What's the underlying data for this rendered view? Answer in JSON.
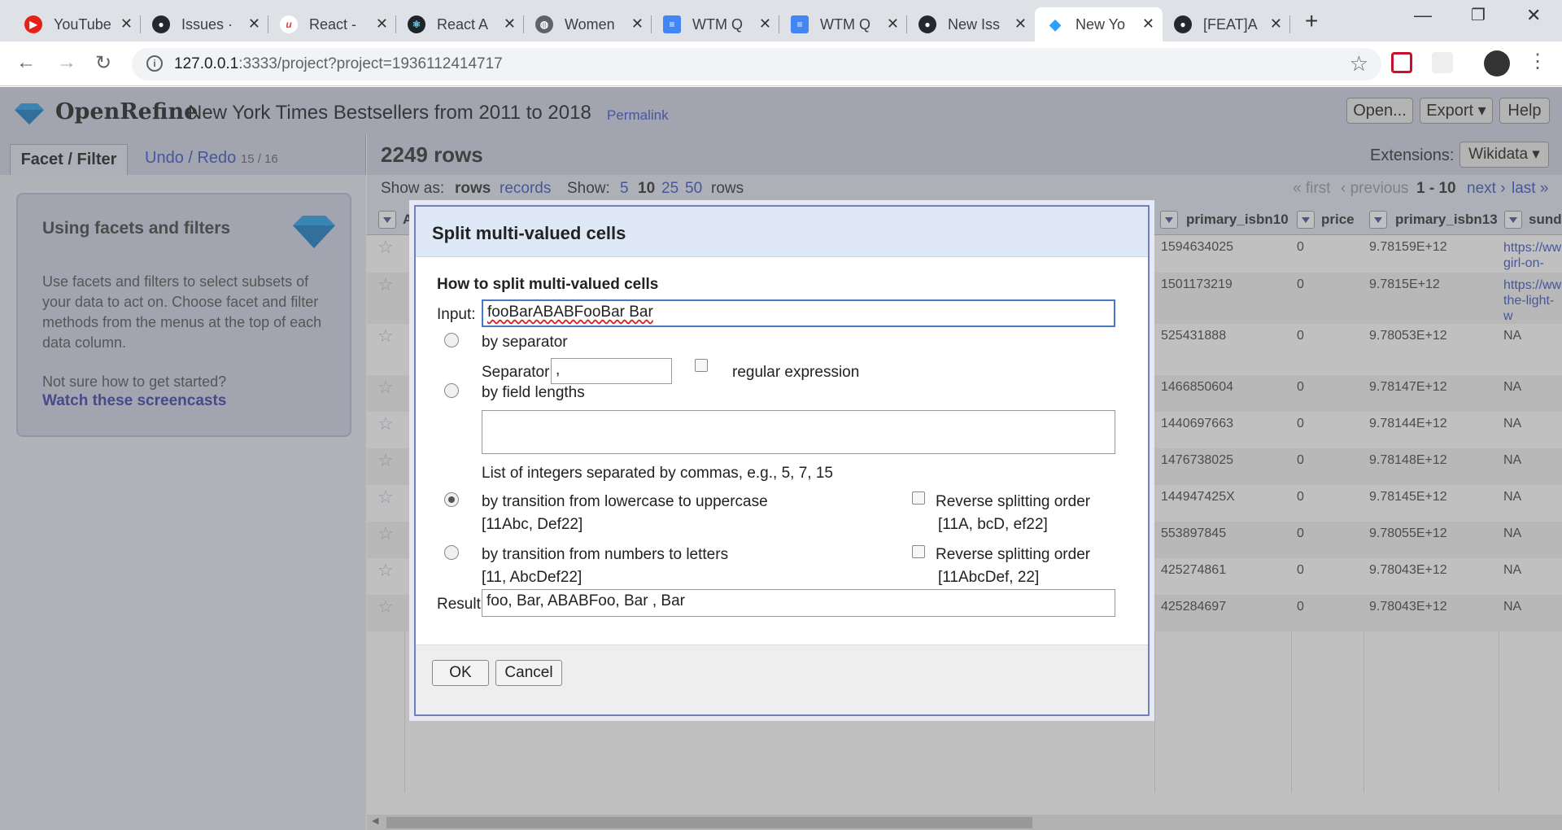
{
  "browser": {
    "tabs": [
      {
        "title": "YouTube",
        "color": "#e62117",
        "glyph": "▶"
      },
      {
        "title": "Issues · ",
        "color": "#24292e",
        "glyph": "●"
      },
      {
        "title": "React - ",
        "color": "#ffffff",
        "glyph": "u"
      },
      {
        "title": "React A",
        "color": "#20232a",
        "glyph": "⚛"
      },
      {
        "title": "Women",
        "color": "#5f6368",
        "glyph": "◍"
      },
      {
        "title": "WTM Q",
        "color": "#4285f4",
        "glyph": "≡"
      },
      {
        "title": "WTM Q",
        "color": "#4285f4",
        "glyph": "≡"
      },
      {
        "title": "New Iss",
        "color": "#24292e",
        "glyph": "●"
      },
      {
        "title": "New Yo",
        "color": "#2ba0ff",
        "glyph": "◆"
      },
      {
        "title": "[FEAT]A",
        "color": "#24292e",
        "glyph": "●"
      }
    ],
    "url_host": "127.0.0.1",
    "url_rest": ":3333/project?project=1936112414717"
  },
  "app": {
    "brand": "OpenRefine",
    "project_title": "New York Times Bestsellers from 2011 to 2018",
    "permalink": "Permalink",
    "open_btn": "Open...",
    "export_btn": "Export ▾",
    "help_btn": "Help"
  },
  "left_panel": {
    "tab_facet": "Facet / Filter",
    "tab_undo": "Undo / Redo",
    "undo_count": "15 / 16",
    "help_title": "Using facets and filters",
    "help_text": "Use facets and filters to select subsets of your data to act on. Choose facet and filter methods from the menus at the top of each data column.",
    "help_hint": "Not sure how to get started?",
    "help_link": "Watch these screencasts"
  },
  "data_panel": {
    "row_count": "2249 rows",
    "extensions_label": "Extensions:",
    "extensions_value": "Wikidata ▾",
    "show_as": "Show as:",
    "rows_mode": "rows",
    "records_mode": "records",
    "show": "Show:",
    "page_sizes": [
      "5",
      "10",
      "25",
      "50"
    ],
    "rows_word": "rows",
    "first": "« first",
    "previous": "‹ previous",
    "range": "1 - 10",
    "next": "next ›",
    "last": "last »",
    "columns": [
      "Al",
      "primary_isbn10",
      "price",
      "primary_isbn13",
      "sunda"
    ],
    "rows": [
      {
        "isbn10": "1594634025",
        "price": "0",
        "isbn13": "9.78159E+12",
        "sunday": [
          "https://ww",
          "girl-on-the"
        ]
      },
      {
        "isbn10": "1501173219",
        "price": "0",
        "isbn13": "9.7815E+12",
        "sunday": [
          "https://ww",
          "the-light-w"
        ]
      },
      {
        "isbn10": "525431888",
        "price": "0",
        "isbn13": "9.78053E+12",
        "sunday": [
          "NA"
        ]
      },
      {
        "isbn10": "1466850604",
        "price": "0",
        "isbn13": "9.78147E+12",
        "sunday": [
          "NA"
        ]
      },
      {
        "isbn10": "1440697663",
        "price": "0",
        "isbn13": "9.78144E+12",
        "sunday": [
          "NA"
        ]
      },
      {
        "isbn10": "1476738025",
        "price": "0",
        "isbn13": "9.78148E+12",
        "sunday": [
          "NA"
        ]
      },
      {
        "isbn10": "144947425X",
        "price": "0",
        "isbn13": "9.78145E+12",
        "sunday": [
          "NA"
        ]
      },
      {
        "isbn10": "553897845",
        "price": "0",
        "isbn13": "9.78055E+12",
        "sunday": [
          "NA"
        ]
      },
      {
        "isbn10": "425274861",
        "price": "0",
        "isbn13": "9.78043E+12",
        "sunday": [
          "NA"
        ]
      },
      {
        "isbn10": "425284697",
        "price": "0",
        "isbn13": "9.78043E+12",
        "sunday": [
          "NA"
        ]
      }
    ]
  },
  "dialog": {
    "title": "Split multi-valued cells",
    "section": "How to split multi-valued cells",
    "input_label": "Input:",
    "input_value": "fooBarABABFooBar Bar",
    "opt_separator": "by separator",
    "separator_label": "Separator",
    "separator_value": ",",
    "regex_label": "regular expression",
    "opt_lengths": "by field lengths",
    "lengths_value": "",
    "lengths_hint": "List of integers separated by commas, e.g., 5, 7, 15",
    "opt_case": "by transition from lowercase to uppercase",
    "case_example": "[11Abc, Def22]",
    "reverse_label": "Reverse splitting order",
    "case_reverse_example": "[11A, bcD, ef22]",
    "opt_numbers": "by transition from numbers to letters",
    "numbers_example": "[11, AbcDef22]",
    "numbers_reverse_example": "[11AbcDef, 22]",
    "result_label": "Result:",
    "result_value": "foo, Bar, ABABFoo, Bar , Bar",
    "ok": "OK",
    "cancel": "Cancel"
  }
}
